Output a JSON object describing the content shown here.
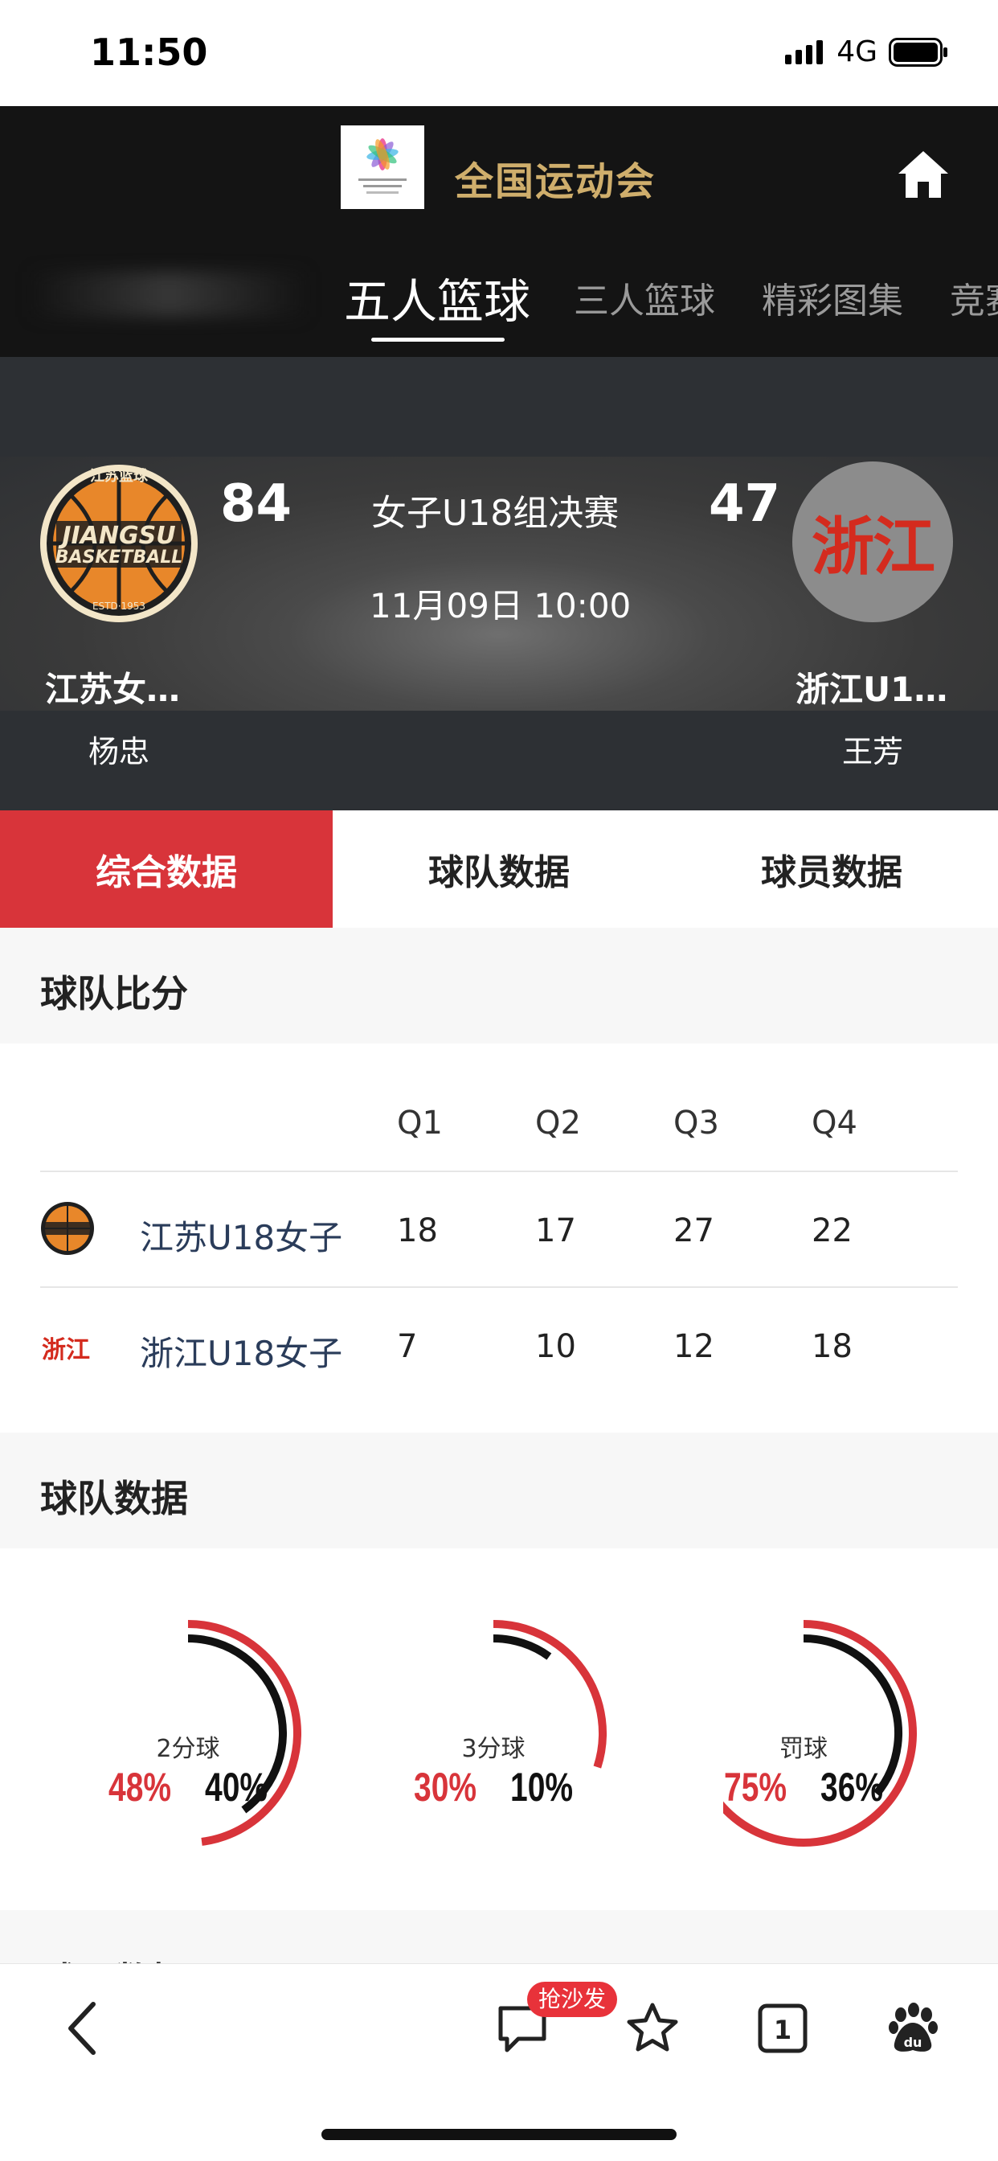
{
  "status_bar": {
    "time": "11:50",
    "network": "4G"
  },
  "header": {
    "app_title": "全国运动会",
    "tabs": [
      {
        "label": "五人篮球",
        "active": true
      },
      {
        "label": "三人篮球",
        "active": false
      },
      {
        "label": "精彩图集",
        "active": false
      },
      {
        "label": "竞赛",
        "active": false
      }
    ]
  },
  "match": {
    "title": "女子U18组决赛",
    "datetime": "11月09日 10:00",
    "home": {
      "name": "江苏女…",
      "coach": "杨忠",
      "score": "84",
      "logo_lines": [
        "江苏篮球",
        "JIANGSU",
        "BASKETBALL",
        "ESTD·1953"
      ]
    },
    "away": {
      "name": "浙江U1…",
      "coach": "王芳",
      "score": "47",
      "logo_text": "浙江"
    }
  },
  "section_tabs": [
    {
      "label": "综合数据",
      "active": true
    },
    {
      "label": "球队数据",
      "active": false
    },
    {
      "label": "球员数据",
      "active": false
    }
  ],
  "score_section": {
    "title": "球队比分",
    "columns": [
      "Q1",
      "Q2",
      "Q3",
      "Q4"
    ],
    "rows": [
      {
        "team": "江苏U18女子",
        "scores": [
          "18",
          "17",
          "27",
          "22"
        ]
      },
      {
        "team": "浙江U18女子",
        "logo_text": "浙江",
        "scores": [
          "7",
          "10",
          "12",
          "18"
        ]
      }
    ]
  },
  "team_stats": {
    "title": "球队数据",
    "items": [
      {
        "label": "2分球",
        "home": "48%",
        "away": "40%",
        "home_value": 0.48,
        "away_value": 0.4
      },
      {
        "label": "3分球",
        "home": "30%",
        "away": "10%",
        "home_value": 0.3,
        "away_value": 0.1
      },
      {
        "label": "罚球",
        "home": "75%",
        "away": "36%",
        "home_value": 0.75,
        "away_value": 0.36
      }
    ],
    "colors": {
      "home": "#d8343a",
      "away": "#111111"
    }
  },
  "next_section": {
    "title": "球员数据"
  },
  "bottom_bar": {
    "badge": "抢沙发",
    "tab_count": "1"
  }
}
